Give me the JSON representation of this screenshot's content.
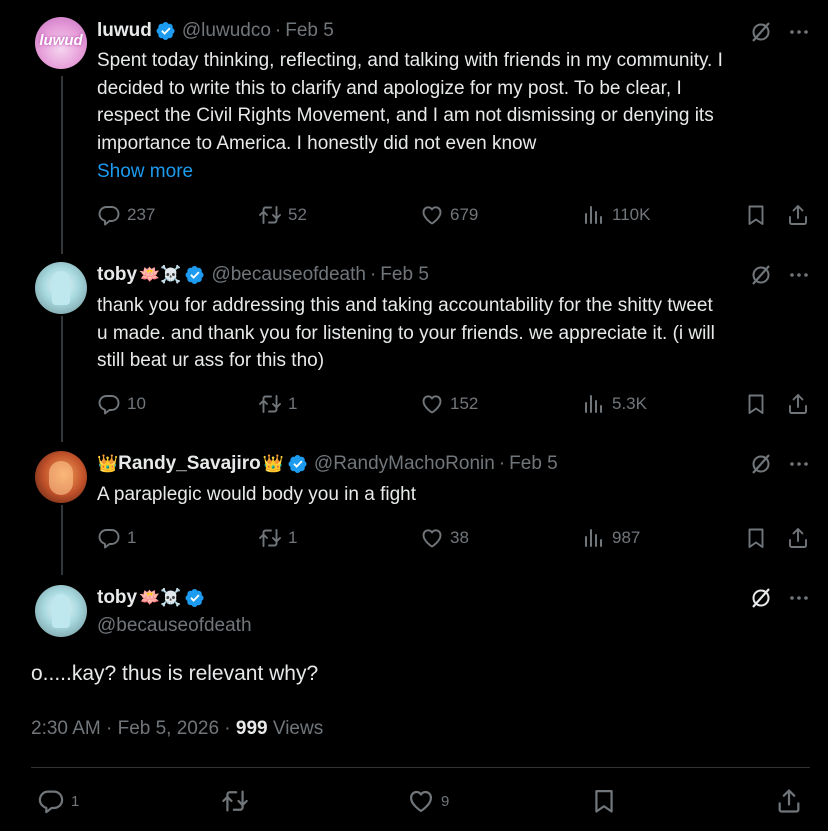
{
  "posts": [
    {
      "name": "luwud",
      "handle": "@luwudco",
      "date": "Feb 5",
      "text_lines": [
        "Spent today thinking, reflecting, and talking with friends in my community. I",
        "decided to write this to clarify and apologize for my post. To be clear, I",
        "respect the Civil Rights Movement, and I am not dismissing or denying its",
        "importance to America. I honestly did not even know"
      ],
      "show_more": "Show more",
      "replies": "237",
      "reposts": "52",
      "likes": "679",
      "views": "110K",
      "avatar_text": "luwud"
    },
    {
      "name": "toby",
      "emojis": "🪷☠️",
      "handle": "@becauseofdeath",
      "date": "Feb 5",
      "text_lines": [
        "thank you for addressing this and taking accountability for the shitty tweet",
        "u made. and thank you for listening to your friends. we appreciate it. (i will",
        "still beat ur ass for this tho)"
      ],
      "replies": "10",
      "reposts": "1",
      "likes": "152",
      "views": "5.3K"
    },
    {
      "name_prefix": "👑",
      "name": "Randy_Savajiro",
      "name_suffix": "👑",
      "handle": "@RandyMachoRonin",
      "date": "Feb 5",
      "text_lines": [
        "A paraplegic would body you in a fight"
      ],
      "replies": "1",
      "reposts": "1",
      "likes": "38",
      "views": "987"
    }
  ],
  "main_post": {
    "name": "toby",
    "emojis": "🪷☠️",
    "handle": "@becauseofdeath",
    "text": "o.....kay? thus is relevant why?",
    "time": "2:30 AM · Feb 5, 2026 · ",
    "views_count": "999",
    "views_label": " Views",
    "replies": "1",
    "likes": "9"
  },
  "colors": {
    "background": "#000000",
    "text": "#e7e9ea",
    "muted": "#71767b",
    "accent": "#1d9bf0",
    "separator": "#2f3336"
  },
  "icons": [
    "verified-badge-icon",
    "grok-icon",
    "more-icon",
    "reply-icon",
    "repost-icon",
    "like-icon",
    "views-icon",
    "bookmark-icon",
    "share-icon"
  ]
}
